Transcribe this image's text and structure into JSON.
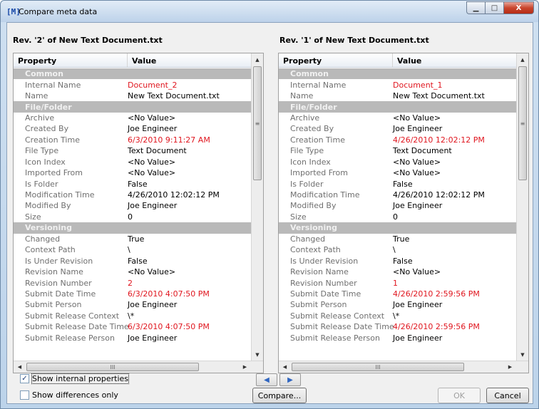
{
  "window": {
    "icon_text": "[M]",
    "title": "Compare meta data",
    "buttons": {
      "minimize": "▁",
      "maximize": "□",
      "close": "X"
    }
  },
  "left_pane": {
    "title": "Rev. '2' of New Text Document.txt",
    "headers": {
      "property": "Property",
      "value": "Value"
    },
    "rows": [
      {
        "type": "category",
        "property": "Common"
      },
      {
        "property": "Internal Name",
        "value": "Document_2",
        "diff": true
      },
      {
        "property": "Name",
        "value": "New Text Document.txt"
      },
      {
        "type": "category",
        "property": "File/Folder"
      },
      {
        "property": "Archive",
        "value": "<No Value>"
      },
      {
        "property": "Created By",
        "value": "Joe Engineer"
      },
      {
        "property": "Creation Time",
        "value": "6/3/2010 9:11:27 AM",
        "diff": true
      },
      {
        "property": "File Type",
        "value": "Text Document"
      },
      {
        "property": "Icon Index",
        "value": "<No Value>"
      },
      {
        "property": "Imported From",
        "value": "<No Value>"
      },
      {
        "property": "Is Folder",
        "value": "False"
      },
      {
        "property": "Modification Time",
        "value": "4/26/2010 12:02:12 PM"
      },
      {
        "property": "Modified By",
        "value": "Joe Engineer"
      },
      {
        "property": "Size",
        "value": "0"
      },
      {
        "type": "category",
        "property": "Versioning"
      },
      {
        "property": "Changed",
        "value": "True"
      },
      {
        "property": "Context Path",
        "value": "\\"
      },
      {
        "property": "Is Under Revision",
        "value": "False"
      },
      {
        "property": "Revision Name",
        "value": "<No Value>"
      },
      {
        "property": "Revision Number",
        "value": "2",
        "diff": true
      },
      {
        "property": "Submit Date Time",
        "value": "6/3/2010 4:07:50 PM",
        "diff": true
      },
      {
        "property": "Submit Person",
        "value": "Joe Engineer"
      },
      {
        "property": "Submit Release Context",
        "value": "\\*"
      },
      {
        "property": "Submit Release Date Time",
        "value": "6/3/2010 4:07:50 PM",
        "diff": true
      },
      {
        "property": "Submit Release Person",
        "value": "Joe Engineer"
      }
    ]
  },
  "right_pane": {
    "title": "Rev. '1' of New Text Document.txt",
    "headers": {
      "property": "Property",
      "value": "Value"
    },
    "rows": [
      {
        "type": "category",
        "property": "Common"
      },
      {
        "property": "Internal Name",
        "value": "Document_1",
        "diff": true
      },
      {
        "property": "Name",
        "value": "New Text Document.txt"
      },
      {
        "type": "category",
        "property": "File/Folder"
      },
      {
        "property": "Archive",
        "value": "<No Value>"
      },
      {
        "property": "Created By",
        "value": "Joe Engineer"
      },
      {
        "property": "Creation Time",
        "value": "4/26/2010 12:02:12 PM",
        "diff": true
      },
      {
        "property": "File Type",
        "value": "Text Document"
      },
      {
        "property": "Icon Index",
        "value": "<No Value>"
      },
      {
        "property": "Imported From",
        "value": "<No Value>"
      },
      {
        "property": "Is Folder",
        "value": "False"
      },
      {
        "property": "Modification Time",
        "value": "4/26/2010 12:02:12 PM"
      },
      {
        "property": "Modified By",
        "value": "Joe Engineer"
      },
      {
        "property": "Size",
        "value": "0"
      },
      {
        "type": "category",
        "property": "Versioning"
      },
      {
        "property": "Changed",
        "value": "True"
      },
      {
        "property": "Context Path",
        "value": "\\"
      },
      {
        "property": "Is Under Revision",
        "value": "False"
      },
      {
        "property": "Revision Name",
        "value": "<No Value>"
      },
      {
        "property": "Revision Number",
        "value": "1",
        "diff": true
      },
      {
        "property": "Submit Date Time",
        "value": "4/26/2010 2:59:56 PM",
        "diff": true
      },
      {
        "property": "Submit Person",
        "value": "Joe Engineer"
      },
      {
        "property": "Submit Release Context",
        "value": "\\*"
      },
      {
        "property": "Submit Release Date Time",
        "value": "4/26/2010 2:59:56 PM",
        "diff": true
      },
      {
        "property": "Submit Release Person",
        "value": "Joe Engineer"
      }
    ]
  },
  "scrollbars": {
    "up_arrow": "▲",
    "down_arrow": "▼",
    "left_arrow": "◀",
    "right_arrow": "▶",
    "v_grip": "≡",
    "h_grip": "III"
  },
  "options": {
    "show_internal_properties": {
      "label": "Show internal properties",
      "checked": true
    },
    "show_differences_only": {
      "label": "Show differences only",
      "checked": false
    }
  },
  "nav": {
    "previous_icon": "◀",
    "next_icon": "▶"
  },
  "buttons": {
    "compare": "Compare...",
    "ok": "OK",
    "cancel": "Cancel"
  },
  "colors": {
    "diff": "#e0161f",
    "category_bg": "#b9b9b9"
  }
}
